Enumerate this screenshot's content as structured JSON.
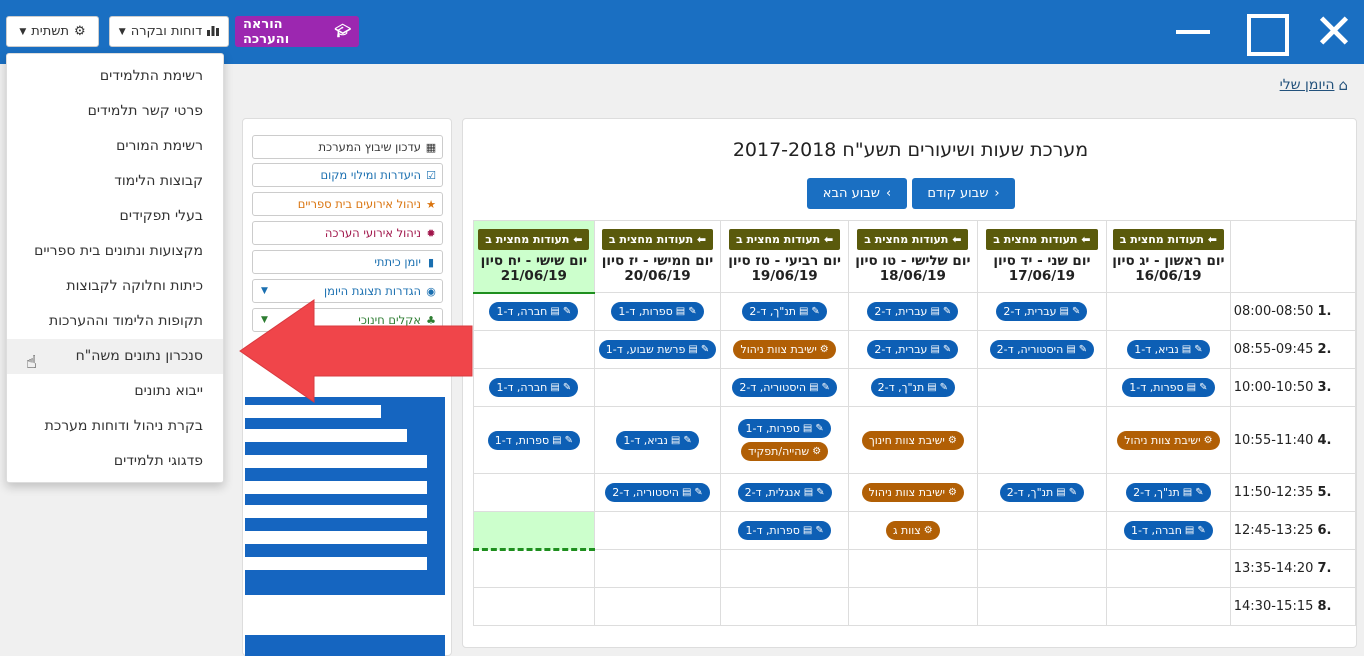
{
  "topbar": {
    "settings_label": "תשתית",
    "reports_label": "דוחות ובקרה",
    "teaching_label": "הוראה והערכה"
  },
  "breadcrumb": {
    "label": "היומן שלי"
  },
  "menu": {
    "items": [
      "רשימת התלמידים",
      "פרטי קשר תלמידים",
      "רשימת המורים",
      "קבוצות הלימוד",
      "בעלי תפקידים",
      "מקצועות ונתונים בית ספריים",
      "כיתות וחלוקה לקבוצות",
      "תקופות הלימוד וההערכות",
      "סנכרון נתונים משה\"ח",
      "ייבוא נתונים",
      "בקרת ניהול ודוחות מערכת",
      "פדגוגי תלמידים"
    ],
    "hovered_index": 8
  },
  "side": {
    "items": [
      {
        "label": "עדכון שיבוץ המערכת",
        "icon": "calendar-icon",
        "color": "#333333"
      },
      {
        "label": "היעדרות ומילוי מקום",
        "icon": "check-icon",
        "color": "#1a6fb0"
      },
      {
        "label": "ניהול אירועים בית ספריים",
        "icon": "star-icon",
        "color": "#d9730d"
      },
      {
        "label": "ניהול אירועי הערכה",
        "icon": "burst-icon",
        "color": "#a0154a"
      },
      {
        "label": "יומן כיתתי",
        "icon": "book-icon",
        "color": "#1a6fb0"
      },
      {
        "label": "הגדרות תצוגת היומן",
        "icon": "eye-icon",
        "color": "#1a6fb0"
      },
      {
        "label": "אקלים חינוכי",
        "icon": "tree-icon",
        "color": "#2e7d32"
      }
    ]
  },
  "schedule": {
    "title": "מערכת שעות ושיעורים תשע\"ח 2017-2018",
    "prev_week": "שבוע קודם",
    "next_week": "שבוע הבא",
    "exit_badge": "תעודות מחצית ב",
    "days": [
      {
        "name": "יום ראשון - יג סיון",
        "date": "16/06/19"
      },
      {
        "name": "יום שני - יד סיון",
        "date": "17/06/19"
      },
      {
        "name": "יום שלישי - טו סיון",
        "date": "18/06/19"
      },
      {
        "name": "יום רביעי - טז סיון",
        "date": "19/06/19"
      },
      {
        "name": "יום חמישי - יז סיון",
        "date": "20/06/19"
      },
      {
        "name": "יום שישי - יח סיון",
        "date": "21/06/19"
      }
    ],
    "rows": [
      {
        "num": "1.",
        "time": "08:00-08:50",
        "cells": [
          [],
          [
            {
              "t": "עברית, ד-2",
              "k": "lesson"
            }
          ],
          [
            {
              "t": "עברית, ד-2",
              "k": "lesson"
            }
          ],
          [
            {
              "t": "תנ\"ך, ד-2",
              "k": "lesson"
            }
          ],
          [
            {
              "t": "ספרות, ד-1",
              "k": "lesson"
            }
          ],
          [
            {
              "t": "חברה, ד-1",
              "k": "lesson"
            }
          ]
        ]
      },
      {
        "num": "2.",
        "time": "08:55-09:45",
        "cells": [
          [
            {
              "t": "נביא, ד-1",
              "k": "lesson"
            }
          ],
          [
            {
              "t": "היסטוריה, ד-2",
              "k": "lesson"
            }
          ],
          [
            {
              "t": "עברית, ד-2",
              "k": "lesson"
            }
          ],
          [
            {
              "t": "ישיבת צוות ניהול",
              "k": "meeting"
            }
          ],
          [
            {
              "t": "פרשת שבוע, ד-1",
              "k": "lesson"
            }
          ],
          []
        ]
      },
      {
        "num": "3.",
        "time": "10:00-10:50",
        "cells": [
          [
            {
              "t": "ספרות, ד-1",
              "k": "lesson"
            }
          ],
          [],
          [
            {
              "t": "תנ\"ך, ד-2",
              "k": "lesson"
            }
          ],
          [
            {
              "t": "היסטוריה, ד-2",
              "k": "lesson"
            }
          ],
          [],
          [
            {
              "t": "חברה, ד-1",
              "k": "lesson"
            }
          ]
        ]
      },
      {
        "num": "4.",
        "time": "10:55-11:40",
        "cells": [
          [
            {
              "t": "ישיבת צוות ניהול",
              "k": "meeting"
            }
          ],
          [],
          [
            {
              "t": "ישיבת צוות חינוך",
              "k": "meeting"
            }
          ],
          [
            {
              "t": "ספרות, ד-1",
              "k": "lesson"
            },
            {
              "t": "שהייה/תפקיד",
              "k": "meeting"
            }
          ],
          [
            {
              "t": "נביא, ד-1",
              "k": "lesson"
            }
          ],
          [
            {
              "t": "ספרות, ד-1",
              "k": "lesson"
            }
          ]
        ]
      },
      {
        "num": "5.",
        "time": "11:50-12:35",
        "cells": [
          [
            {
              "t": "תנ\"ך, ד-2",
              "k": "lesson"
            }
          ],
          [
            {
              "t": "תנ\"ך, ד-2",
              "k": "lesson"
            }
          ],
          [
            {
              "t": "ישיבת צוות ניהול",
              "k": "meeting"
            }
          ],
          [
            {
              "t": "אנגלית, ד-2",
              "k": "lesson"
            }
          ],
          [
            {
              "t": "היסטוריה, ד-2",
              "k": "lesson"
            }
          ],
          []
        ]
      },
      {
        "num": "6.",
        "time": "12:45-13:25",
        "cells": [
          [
            {
              "t": "חברה, ד-1",
              "k": "lesson"
            }
          ],
          [],
          [
            {
              "t": "צוות ג",
              "k": "meeting"
            }
          ],
          [
            {
              "t": "ספרות, ד-1",
              "k": "lesson"
            }
          ],
          [],
          []
        ]
      },
      {
        "num": "7.",
        "time": "13:35-14:20",
        "cells": [
          [],
          [],
          [],
          [],
          [],
          []
        ]
      },
      {
        "num": "8.",
        "time": "14:30-15:15",
        "cells": [
          [],
          [],
          [],
          [],
          [],
          []
        ]
      }
    ]
  },
  "colors": {
    "brand": "#1a6fc2",
    "purple": "#9c27b0",
    "lesson": "#0d5fb5",
    "meeting": "#b15f05",
    "today": "#ccffcc",
    "arrow": "#f0454a"
  }
}
